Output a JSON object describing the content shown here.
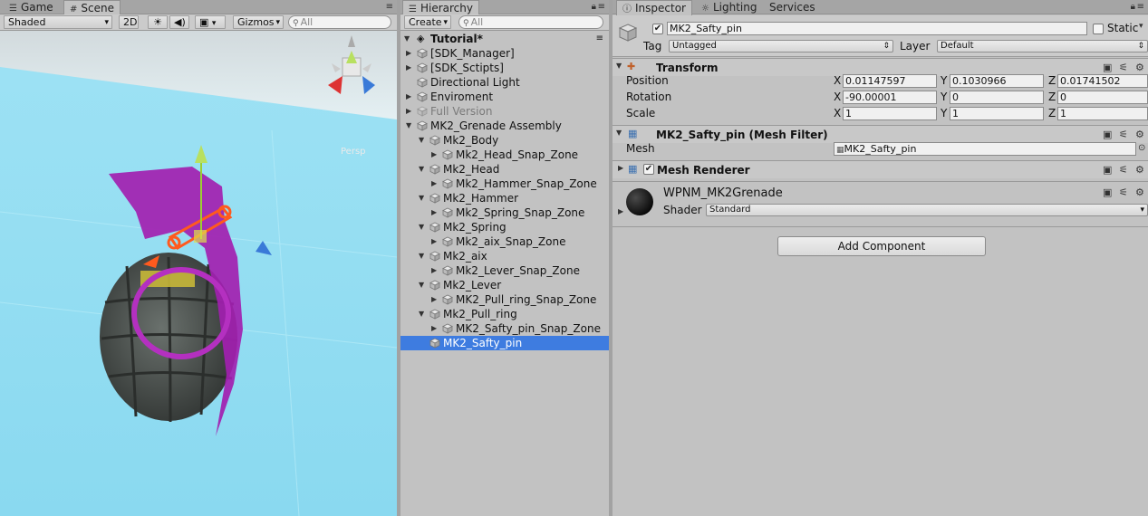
{
  "scene_panel": {
    "tabs": [
      {
        "label": "Game",
        "icon": "game-controller-icon"
      },
      {
        "label": "Scene",
        "icon": "grid-icon"
      }
    ],
    "toolbar": {
      "shading_mode": "Shaded",
      "toggle_2d": "2D",
      "gizmos": "Gizmos",
      "search_placeholder": "All"
    },
    "camera_label": "Persp",
    "colors": {
      "sky": "#d9e9ee",
      "ground": "#8fdcf3",
      "selection": "#b530c0",
      "grenade": "#4e5350"
    }
  },
  "hierarchy": {
    "tab": "Hierarchy",
    "create_label": "Create",
    "search_placeholder": "All",
    "root": "Tutorial*",
    "items": [
      {
        "label": "[SDK_Manager]",
        "arrow": "▶",
        "selected": false,
        "dim": false
      },
      {
        "label": "[SDK_Sctipts]",
        "arrow": "▶",
        "selected": false,
        "dim": false
      },
      {
        "label": "Directional Light",
        "arrow": "",
        "selected": false,
        "dim": false
      },
      {
        "label": "Enviroment",
        "arrow": "▶",
        "selected": false,
        "dim": false
      },
      {
        "label": "Full Version",
        "arrow": "▶",
        "selected": false,
        "dim": true
      },
      {
        "label": "MK2_Grenade Assembly",
        "arrow": "▼",
        "selected": false,
        "dim": false
      },
      {
        "label": "Mk2_Body",
        "arrow": "▼",
        "selected": false,
        "dim": false
      },
      {
        "label": "Mk2_Head_Snap_Zone",
        "arrow": "▶",
        "selected": false,
        "dim": false
      },
      {
        "label": "Mk2_Head",
        "arrow": "▼",
        "selected": false,
        "dim": false
      },
      {
        "label": "Mk2_Hammer_Snap_Zone",
        "arrow": "▶",
        "selected": false,
        "dim": false
      },
      {
        "label": "Mk2_Hammer",
        "arrow": "▼",
        "selected": false,
        "dim": false
      },
      {
        "label": "Mk2_Spring_Snap_Zone",
        "arrow": "▶",
        "selected": false,
        "dim": false
      },
      {
        "label": "Mk2_Spring",
        "arrow": "▼",
        "selected": false,
        "dim": false
      },
      {
        "label": "Mk2_aix_Snap_Zone",
        "arrow": "▶",
        "selected": false,
        "dim": false
      },
      {
        "label": "Mk2_aix",
        "arrow": "▼",
        "selected": false,
        "dim": false
      },
      {
        "label": "Mk2_Lever_Snap_Zone",
        "arrow": "▶",
        "selected": false,
        "dim": false
      },
      {
        "label": "Mk2_Lever",
        "arrow": "▼",
        "selected": false,
        "dim": false
      },
      {
        "label": "MK2_Pull_ring_Snap_Zone",
        "arrow": "▶",
        "selected": false,
        "dim": false
      },
      {
        "label": "Mk2_Pull_ring",
        "arrow": "▼",
        "selected": false,
        "dim": false
      },
      {
        "label": "MK2_Safty_pin_Snap_Zone",
        "arrow": "▶",
        "selected": false,
        "dim": false
      },
      {
        "label": "MK2_Safty_pin",
        "arrow": "",
        "selected": true,
        "dim": false
      }
    ],
    "selection_color": "#3e7ce0"
  },
  "inspector": {
    "tabs": [
      {
        "label": "Inspector",
        "icon": "info-icon"
      },
      {
        "label": "Lighting",
        "icon": "lighting-icon"
      },
      {
        "label": "Services",
        "icon": ""
      }
    ],
    "object_name": "MK2_Safty_pin",
    "active": true,
    "static_label": "Static",
    "tag_label": "Tag",
    "tag_value": "Untagged",
    "layer_label": "Layer",
    "layer_value": "Default",
    "transform": {
      "title": "Transform",
      "position_label": "Position",
      "rotation_label": "Rotation",
      "scale_label": "Scale",
      "position": {
        "x": "0.01147597",
        "y": "0.1030966",
        "z": "0.01741502"
      },
      "rotation": {
        "x": "-90.00001",
        "y": "0",
        "z": "0"
      },
      "scale": {
        "x": "1",
        "y": "1",
        "z": "1"
      }
    },
    "mesh_filter": {
      "title": "MK2_Safty_pin (Mesh Filter)",
      "mesh_label": "Mesh",
      "mesh_value": "MK2_Safty_pin"
    },
    "mesh_renderer": {
      "title": "Mesh Renderer",
      "enabled": true
    },
    "material": {
      "name": "WPNM_MK2Grenade",
      "shader_label": "Shader",
      "shader_value": "Standard"
    },
    "add_component": "Add Component"
  }
}
